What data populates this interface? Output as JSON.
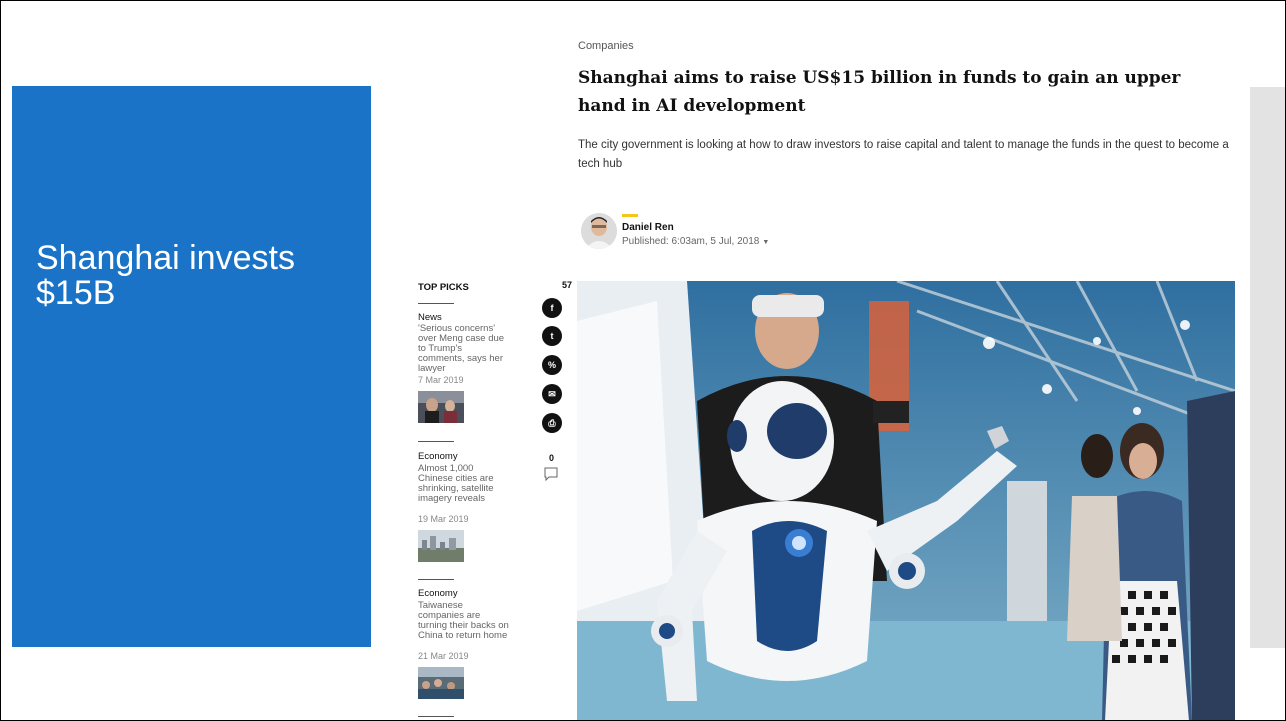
{
  "slide": {
    "title": "Shanghai invests $15B"
  },
  "article": {
    "category": "Companies",
    "headline": "Shanghai aims to raise US$15 billion in funds to gain an upper hand in AI development",
    "summary": "The city government is looking at how to draw investors to raise capital and talent to manage the funds in the quest to become a tech hub",
    "author": "Daniel Ren",
    "published": "Published: 6:03am, 5 Jul, 2018"
  },
  "top_picks": {
    "heading": "TOP PICKS",
    "items": [
      {
        "category": "News",
        "title": "'Serious concerns' over Meng case due to Trump's comments, says her lawyer",
        "date": "7 Mar 2019"
      },
      {
        "category": "Economy",
        "title": "Almost 1,000 Chinese cities are shrinking, satellite imagery reveals",
        "date": "19 Mar 2019"
      },
      {
        "category": "Economy",
        "title": "Taiwanese companies are turning their backs on China to return home",
        "date": "21 Mar 2019"
      }
    ]
  },
  "share": {
    "count": "57",
    "buttons": [
      {
        "name": "facebook-icon",
        "glyph": "f"
      },
      {
        "name": "twitter-icon",
        "glyph": "t"
      },
      {
        "name": "link-icon",
        "glyph": "%"
      },
      {
        "name": "email-icon",
        "glyph": "✉"
      },
      {
        "name": "print-icon",
        "glyph": "⎙"
      }
    ],
    "comment_count": "0"
  },
  "colors": {
    "slide_blue": "#1a73c7",
    "author_accent": "#f5c518",
    "gray_box": "#e3e3e3"
  }
}
